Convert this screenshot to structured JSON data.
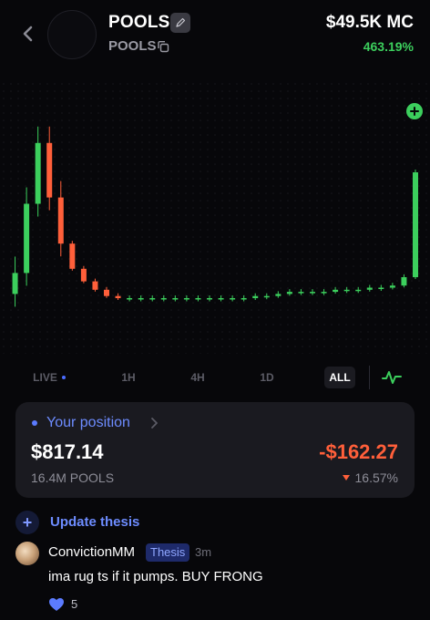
{
  "header": {
    "token_name": "POOLS",
    "ticker": "POOLS",
    "market_cap": "$49.5K MC",
    "change_pct": "463.19%",
    "icons": [
      "back-chevron-icon",
      "pencil-icon",
      "copy-icon"
    ]
  },
  "chart": {
    "type": "candlestick",
    "colors": {
      "up": "#3ccf5d",
      "down": "#ff5f3a",
      "dot_grid": "#17171d"
    },
    "latest_marker_icon": "plus-icon",
    "relative_levels": [
      0.12,
      0.22,
      0.55,
      0.84,
      0.58,
      0.36,
      0.24,
      0.18,
      0.14,
      0.11,
      0.1,
      0.1,
      0.1,
      0.1,
      0.1,
      0.1,
      0.1,
      0.1,
      0.1,
      0.1,
      0.1,
      0.1,
      0.11,
      0.11,
      0.12,
      0.13,
      0.13,
      0.13,
      0.13,
      0.14,
      0.14,
      0.14,
      0.15,
      0.15,
      0.16,
      0.2,
      0.7
    ]
  },
  "ranges": {
    "items": [
      "LIVE",
      "1H",
      "4H",
      "1D",
      "ALL"
    ],
    "selected": "ALL",
    "chart_type_icon": "pulse-line-icon"
  },
  "position": {
    "title": "Your position",
    "value": "$817.14",
    "amount": "16.4M POOLS",
    "pnl": "-$162.27",
    "pnl_pct": "16.57%",
    "pnl_direction_icon": "down-triangle-icon"
  },
  "thesis": {
    "button_label": "Update thesis",
    "icon": "plus-icon"
  },
  "comments": [
    {
      "user": "ConvictionMM",
      "badge": "Thesis",
      "time": "3m",
      "text": "ima rug ts if it pumps. BUY FRONG",
      "likes": "5"
    }
  ]
}
